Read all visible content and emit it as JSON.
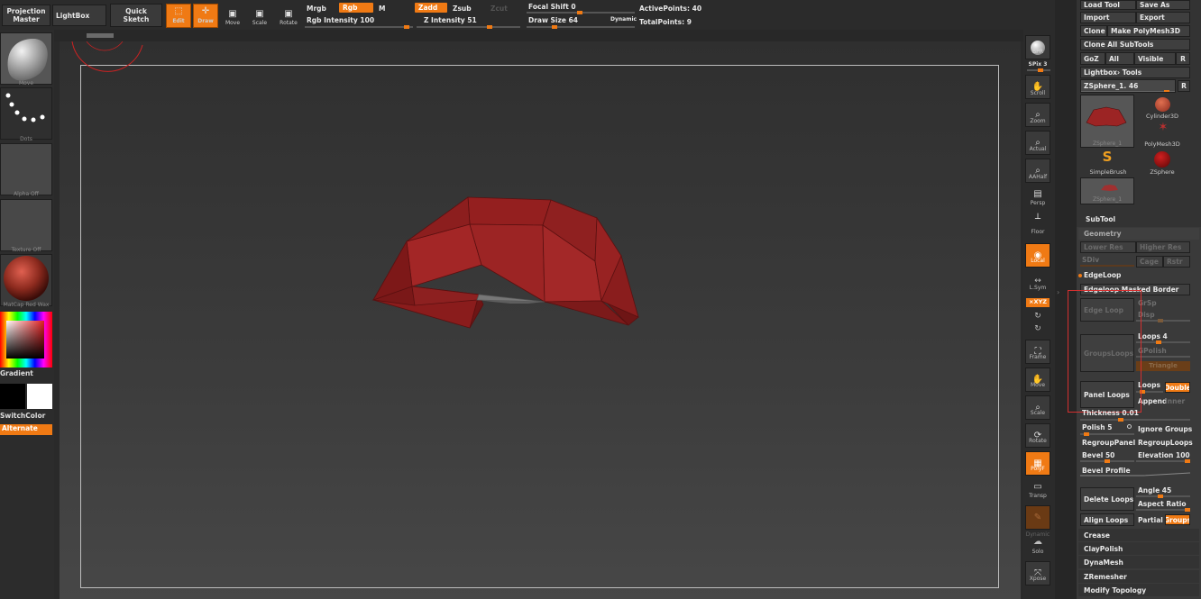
{
  "top": {
    "projection_master": "Projection\nMaster",
    "lightbox": "LightBox",
    "quick_sketch": "Quick\nSketch",
    "edit": "Edit",
    "draw": "Draw",
    "move": "Move",
    "scale": "Scale",
    "rotate": "Rotate",
    "mrgb": "Mrgb",
    "rgb": "Rgb",
    "m": "M",
    "zadd": "Zadd",
    "zsub": "Zsub",
    "zcut": "Zcut",
    "rgb_intensity": "Rgb Intensity 100",
    "z_intensity": "Z Intensity 51",
    "focal_shift": "Focal Shift 0",
    "draw_size": "Draw Size 64",
    "dynamic": "Dynamic",
    "active_points": "ActivePoints: 40",
    "total_points": "TotalPoints: 9"
  },
  "left": {
    "brush": "Move",
    "stroke": "Dots",
    "alpha": "Alpha Off",
    "texture": "Texture Off",
    "material": "MatCap Red Wax",
    "gradient": "Gradient",
    "switchcolor": "SwitchColor",
    "alternate": "Alternate"
  },
  "right_shelf": {
    "bpr": "BPR",
    "spix": "SPix 3",
    "scroll": "Scroll",
    "zoom": "Zoom",
    "actual": "Actual",
    "aahalf": "AAHalf",
    "persp": "Persp",
    "floor": "Floor",
    "local": "Local",
    "lsym": "L.Sym",
    "xyz": "×XYZ",
    "frame": "Frame",
    "move": "Move",
    "scale": "Scale",
    "rotate": "Rotate",
    "polyf": "PolyF",
    "transp": "Transp",
    "dynamic": "Dynamic",
    "solo": "Solo",
    "xpose": "Xpose"
  },
  "tool": {
    "load_tool": "Load Tool",
    "save_as": "Save As",
    "import": "Import",
    "export": "Export",
    "clone": "Clone",
    "make_polymesh": "Make PolyMesh3D",
    "clone_all": "Clone All SubTools",
    "goz": "GoZ",
    "all": "All",
    "visible": "Visible",
    "r": "R",
    "lightbox_tools": "Lightbox› Tools",
    "current_tool": "ZSphere_1. 46",
    "r2": "R",
    "thumb_main": "ZSphere_1",
    "cylinder": "Cylinder3D",
    "polymesh": "PolyMesh3D",
    "simplebrush": "SimpleBrush",
    "zsphere": "ZSphere",
    "thumb_small": "ZSphere_1"
  },
  "subtool": {
    "subtool": "SubTool",
    "geometry": "Geometry",
    "lower_res": "Lower Res",
    "higher_res": "Higher Res",
    "sdiv": "SDiv",
    "cage": "Cage",
    "rstr": "Rstr",
    "edgeloop": "EdgeLoop",
    "edgeloop_masked": "Edgeloop Masked Border",
    "edge_loop": "Edge Loop",
    "grsp": "GrSp",
    "disp": "Disp",
    "loops4": "Loops 4",
    "grouploops": "GroupsLoops",
    "gpolish": "GPolish",
    "triangle": "Triangle",
    "panel_loops": "Panel Loops",
    "loops": "Loops",
    "double": "Double",
    "append": "Append",
    "inner": "Inner",
    "thickness": "Thickness 0.01",
    "polish": "Polish 5",
    "ignore_groups": "Ignore Groups",
    "regroup_panel": "RegroupPanel",
    "regroup_loops": "RegroupLoops",
    "bevel": "Bevel 50",
    "elevation": "Elevation 100",
    "bevel_profile": "Bevel Profile",
    "delete_loops": "Delete Loops",
    "angle": "Angle 45",
    "aspect_ratio": "Aspect Ratio",
    "align_loops": "Align Loops",
    "partial": "Partial",
    "groups": "Groups",
    "crease": "Crease",
    "claypolish": "ClayPolish",
    "dynamesh": "DynaMesh",
    "zremesher": "ZRemesher",
    "modify_topology": "Modify Topology"
  },
  "colors": {
    "accent": "#f07a14",
    "mesh": "#9c2424",
    "highlight_box": "#d43030"
  }
}
